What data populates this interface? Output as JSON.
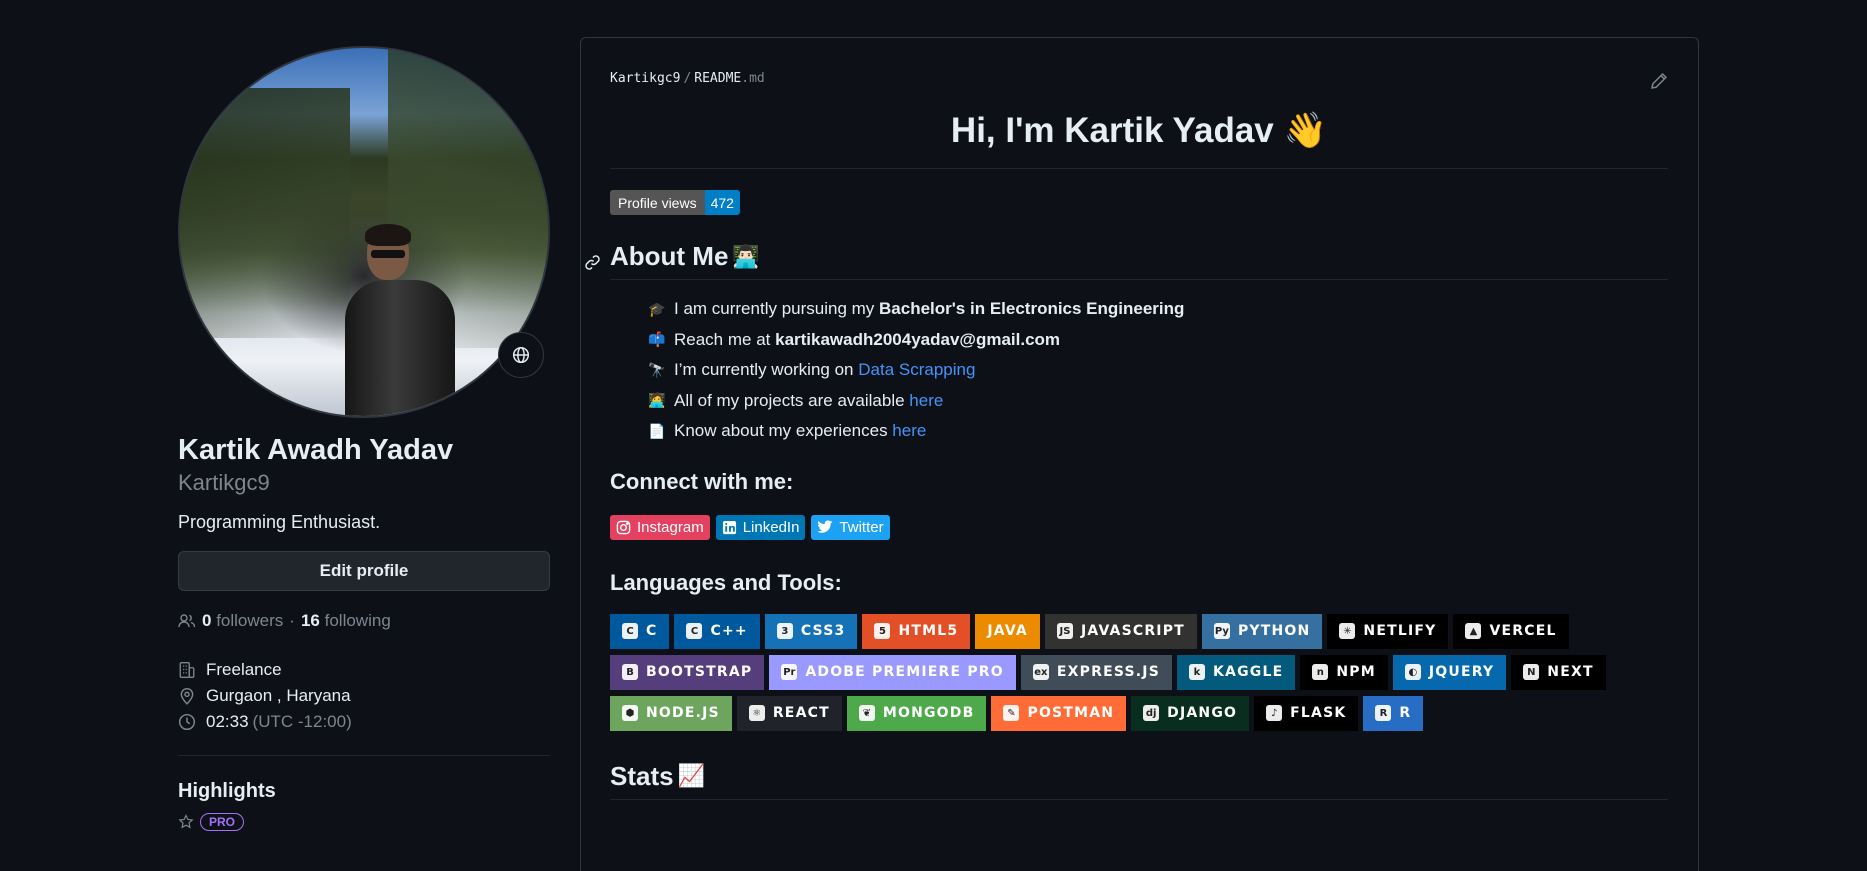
{
  "profile": {
    "full_name": "Kartik Awadh Yadav",
    "login": "Kartikgc9",
    "bio": "Programming Enthusiast.",
    "edit_label": "Edit profile",
    "followers_count": "0",
    "followers_label": "followers",
    "following_count": "16",
    "following_label": "following",
    "company": "Freelance",
    "location": "Gurgaon , Haryana",
    "local_time": "02:33",
    "timezone": "(UTC -12:00)",
    "highlights_title": "Highlights",
    "pro_label": "PRO"
  },
  "readme": {
    "breadcrumb_user": "Kartikgc9",
    "breadcrumb_sep": "/",
    "breadcrumb_file": "README",
    "breadcrumb_ext": ".md",
    "title": "Hi, I'm Kartik Yadav 👋",
    "views_label": "Profile views",
    "views_count": "472",
    "about_title": "About Me",
    "about_emoji": "👨🏻‍💻",
    "about_items": [
      {
        "emoji": "🎓",
        "text": "I am currently pursuing my ",
        "bold": "Bachelor's in Electronics Engineering",
        "link": ""
      },
      {
        "emoji": "📫",
        "text": "Reach me at ",
        "bold": "kartikawadh2004yadav@gmail.com",
        "link": ""
      },
      {
        "emoji": "🔭",
        "text": "I’m currently working on ",
        "bold": "",
        "link": "Data Scrapping"
      },
      {
        "emoji": "🧑‍💻",
        "text": "All of my projects are available ",
        "bold": "",
        "link": "here"
      },
      {
        "emoji": "📄",
        "text": "Know about my experiences ",
        "bold": "",
        "link": "here"
      }
    ],
    "connect_title": "Connect with me:",
    "social": [
      {
        "label": "Instagram",
        "icon": "instagram-icon",
        "color": "#E4405F"
      },
      {
        "label": "LinkedIn",
        "icon": "linkedin-icon",
        "color": "#0077B5"
      },
      {
        "label": "Twitter",
        "icon": "twitter-icon",
        "color": "#1DA1F2"
      }
    ],
    "tools_title": "Languages and Tools:",
    "tools": [
      {
        "label": "C",
        "color": "#00599C",
        "icon": "c-icon"
      },
      {
        "label": "C++",
        "color": "#00599C",
        "icon": "cpp-icon"
      },
      {
        "label": "CSS3",
        "color": "#1572B6",
        "icon": "css3-icon"
      },
      {
        "label": "HTML5",
        "color": "#E34F26",
        "icon": "html5-icon"
      },
      {
        "label": "JAVA",
        "color": "#ED8B00",
        "icon": ""
      },
      {
        "label": "JAVASCRIPT",
        "color": "#323330",
        "icon": "javascript-icon"
      },
      {
        "label": "PYTHON",
        "color": "#3670A0",
        "icon": "python-icon"
      },
      {
        "label": "NETLIFY",
        "color": "#000000",
        "icon": "netlify-icon"
      },
      {
        "label": "VERCEL",
        "color": "#000000",
        "icon": "vercel-icon"
      },
      {
        "label": "BOOTSTRAP",
        "color": "#563D7C",
        "icon": "bootstrap-icon"
      },
      {
        "label": "ADOBE PREMIERE PRO",
        "color": "#9999FF",
        "icon": "premiere-icon"
      },
      {
        "label": "EXPRESS.JS",
        "color": "#404D59",
        "icon": "express-icon"
      },
      {
        "label": "KAGGLE",
        "color": "#035A7D",
        "icon": "kaggle-icon"
      },
      {
        "label": "NPM",
        "color": "#000000",
        "icon": "npm-icon"
      },
      {
        "label": "JQUERY",
        "color": "#0769AD",
        "icon": "jquery-icon"
      },
      {
        "label": "NEXT",
        "color": "#000000",
        "icon": "next-icon"
      },
      {
        "label": "NODE.JS",
        "color": "#6DA55F",
        "icon": "nodejs-icon"
      },
      {
        "label": "REACT",
        "color": "#20232A",
        "icon": "react-icon"
      },
      {
        "label": "MONGODB",
        "color": "#4EA94B",
        "icon": "mongodb-icon"
      },
      {
        "label": "POSTMAN",
        "color": "#FF6C37",
        "icon": "postman-icon"
      },
      {
        "label": "DJANGO",
        "color": "#092E20",
        "icon": "django-icon"
      },
      {
        "label": "FLASK",
        "color": "#000000",
        "icon": "flask-icon"
      },
      {
        "label": "R",
        "color": "#276DC3",
        "icon": "r-icon"
      }
    ],
    "stats_title": "Stats",
    "stats_emoji": "📈"
  }
}
